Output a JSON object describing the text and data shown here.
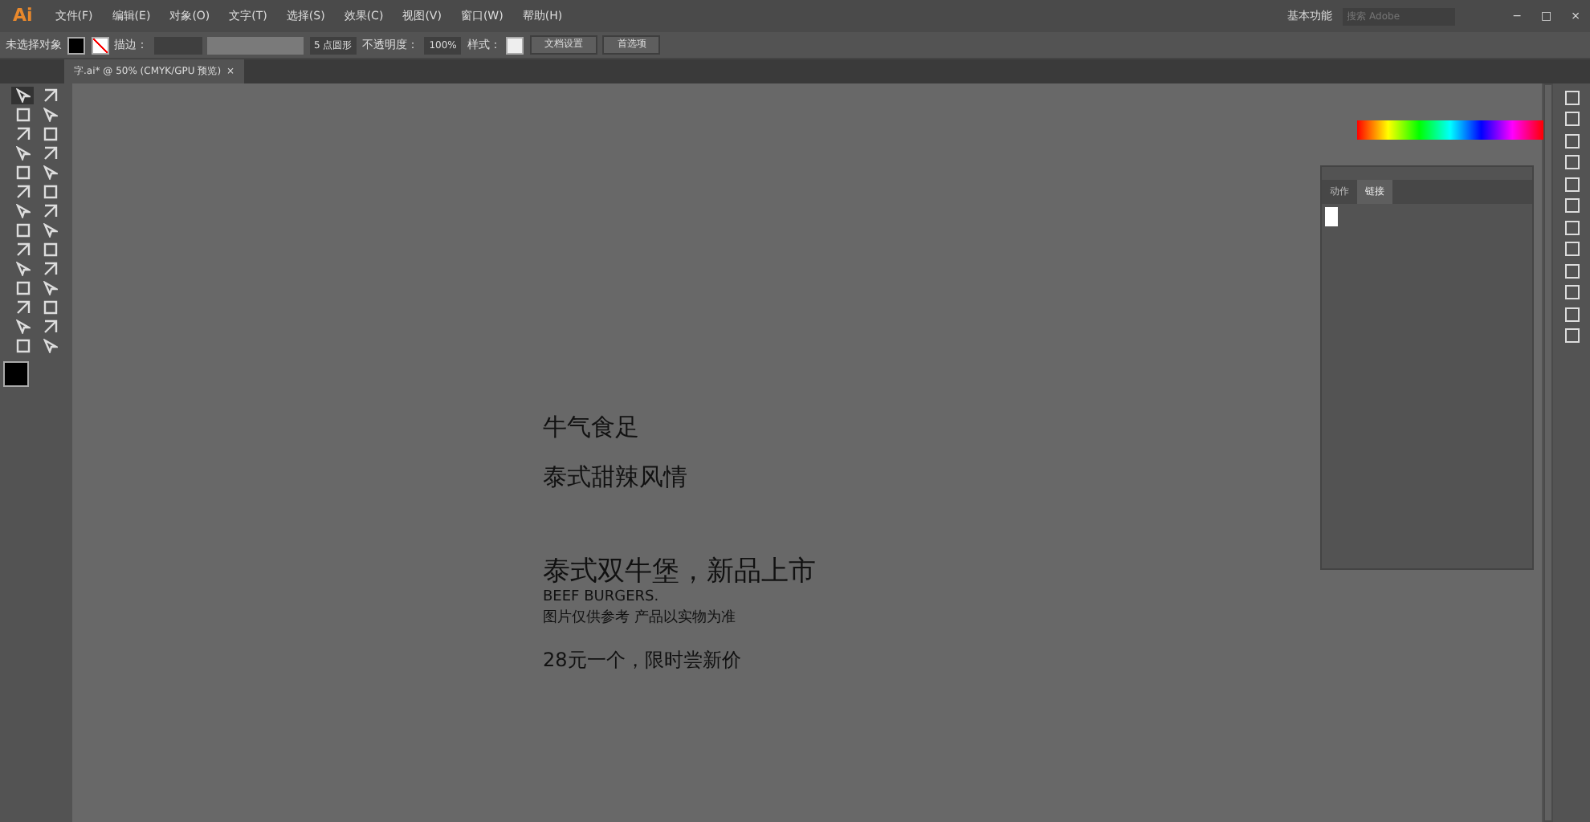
{
  "app_logo": "Ai",
  "menu": [
    "文件(F)",
    "编辑(E)",
    "对象(O)",
    "文字(T)",
    "选择(S)",
    "效果(C)",
    "视图(V)",
    "窗口(W)",
    "帮助(H)"
  ],
  "workspace": "基本功能",
  "search": {
    "placeholder": "搜索 Adobe"
  },
  "window_controls": [
    "−",
    "□",
    "×"
  ],
  "control_bar": {
    "selection": "未选择对象",
    "stroke_label": "描边：",
    "brush": "5 点圆形",
    "opacity_label": "不透明度：",
    "opacity": "100%",
    "style_label": "样式：",
    "buttons": [
      "文档设置",
      "首选项"
    ]
  },
  "document_tab": {
    "title": "字.ai* @ 50% (CMYK/GPU 预览)",
    "close": "×"
  },
  "tools": [
    {
      "selected": true
    },
    {
      "selected": false
    },
    {
      "selected": false
    },
    {
      "selected": false
    },
    {
      "selected": false
    },
    {
      "selected": false
    },
    {
      "selected": false
    },
    {
      "selected": false
    },
    {
      "selected": false
    },
    {
      "selected": false
    },
    {
      "selected": false
    },
    {
      "selected": false
    },
    {
      "selected": false
    },
    {
      "selected": false
    },
    {
      "selected": false
    },
    {
      "selected": false
    },
    {
      "selected": false
    },
    {
      "selected": false
    },
    {
      "selected": false
    },
    {
      "selected": false
    },
    {
      "selected": false
    },
    {
      "selected": false
    },
    {
      "selected": false
    },
    {
      "selected": false
    },
    {
      "selected": false
    },
    {
      "selected": false
    },
    {
      "selected": false
    },
    {
      "selected": false
    }
  ],
  "artboard_texts": [
    {
      "text": "牛气食足",
      "kind": "subhead"
    },
    {
      "text": "泰式甜辣风情",
      "kind": "subhead"
    },
    {
      "text": "泰式双牛堡，新品上市",
      "kind": "headline"
    },
    {
      "text": "BEEF BURGERS.",
      "kind": "small"
    },
    {
      "text": "图片仅供参考 产品以实物为准",
      "kind": "small"
    },
    {
      "text": "28元一个，限时尝新价",
      "kind": "price"
    }
  ],
  "links_panel": {
    "tabs": [
      {
        "label": "动作",
        "selected": false
      },
      {
        "label": "链接",
        "selected": true
      }
    ]
  }
}
